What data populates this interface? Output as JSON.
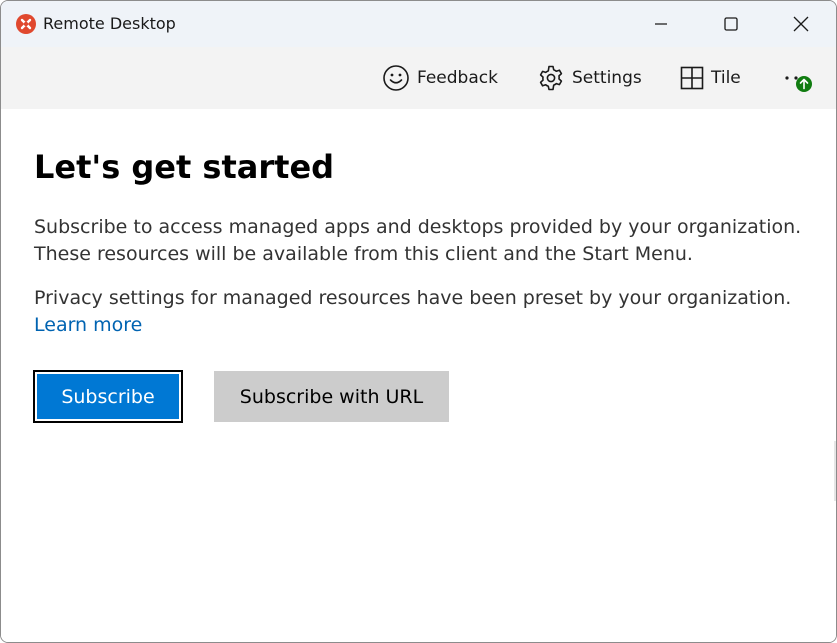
{
  "window": {
    "title": "Remote Desktop",
    "icon": "remote-desktop-logo-icon",
    "controls": [
      "minimize-icon",
      "maximize-icon",
      "close-icon"
    ]
  },
  "toolbar": {
    "feedback_label": "Feedback",
    "settings_label": "Settings",
    "tile_label": "Tile",
    "more_icon": "more-ellipsis-icon",
    "update_badge_icon": "update-arrow-icon"
  },
  "main": {
    "heading": "Let's get started",
    "para1_line1": "Subscribe to access managed apps and desktops provided by your organization.",
    "para1_line2": "These resources will be available from this client and the Start Menu.",
    "para2_line1": "Privacy settings for managed resources have been preset by your organization.",
    "learn_more": "Learn more",
    "subscribe_label": "Subscribe",
    "subscribe_url_label": "Subscribe with URL"
  },
  "colors": {
    "accent": "#0078d4",
    "link": "#0063b1",
    "secondary_button": "#cccccc",
    "badge": "#107c10",
    "logo": "#e0482e"
  }
}
